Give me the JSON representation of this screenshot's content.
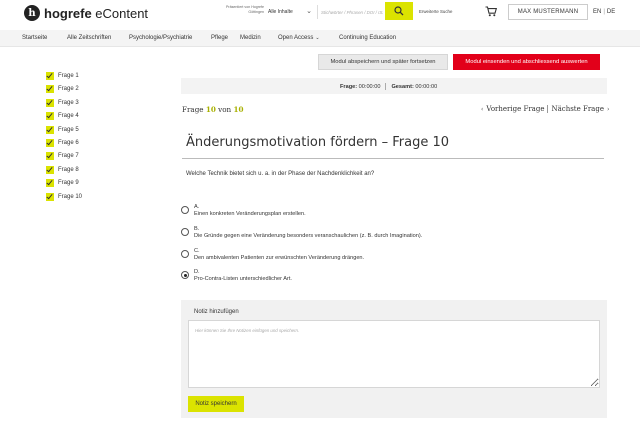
{
  "header": {
    "logo_mark": "h",
    "logo_brand": "hogrefe",
    "logo_product": " eContent",
    "presented_by": "Präsentiert von Hogrefe Göttingen",
    "scope_label": "Alle Inhalte",
    "search_placeholder": "Stichwörter / Phrasen / DOI / ISSN / ...",
    "advanced_search": "Erweiterte Suche",
    "user_name": "MAX MUSTERMANN",
    "lang_en": "EN",
    "lang_separator": "|",
    "lang_de": "DE",
    "accent_color": "#dbe300"
  },
  "nav": {
    "items": [
      "Startseite",
      "Alle Zeitschriften",
      "Psychologie/Psychiatrie",
      "Pflege",
      "Medizin",
      "Open Access",
      "Continuing Education"
    ]
  },
  "sidebar": {
    "items": [
      {
        "label": "Frage 1",
        "done": true
      },
      {
        "label": "Frage 2",
        "done": true
      },
      {
        "label": "Frage 3",
        "done": true
      },
      {
        "label": "Frage 4",
        "done": true
      },
      {
        "label": "Frage 5",
        "done": true
      },
      {
        "label": "Frage 6",
        "done": true
      },
      {
        "label": "Frage 7",
        "done": true
      },
      {
        "label": "Frage 8",
        "done": true
      },
      {
        "label": "Frage 9",
        "done": true
      },
      {
        "label": "Frage 10",
        "done": true
      }
    ]
  },
  "actions": {
    "save_later": "Modul abspeichern und später fortsetzen",
    "submit": "Modul einsenden und abschliessend auswerten",
    "submit_color": "#e2001a"
  },
  "timer": {
    "question_label": "Frage:",
    "question_time": "00:00:00",
    "total_label": "Gesamt:",
    "total_time": "00:00:00"
  },
  "question": {
    "counter_prefix": "Frage",
    "current": "10",
    "counter_of": "von",
    "total": "10",
    "prev_label": "Vorherige Frage",
    "next_label": "Nächste Frage",
    "title": "Änderungsmotivation fördern – Frage 10",
    "text": "Welche Technik bietet sich u. a. in der Phase der Nachdenklichkeit an?",
    "options": [
      {
        "letter": "A.",
        "text": "Einen konkreten Veränderungsplan erstellen.",
        "selected": false
      },
      {
        "letter": "B.",
        "text": "Die Gründe gegen eine Veränderung besonders veranschaulichen (z. B. durch Imagination).",
        "selected": false
      },
      {
        "letter": "C.",
        "text": "Den ambivalenten Patienten zur erwünschten Veränderung drängen.",
        "selected": false
      },
      {
        "letter": "D.",
        "text": "Pro-Contra-Listen unterschiedlicher Art.",
        "selected": true
      }
    ]
  },
  "note": {
    "label": "Notiz hinzufügen",
    "placeholder": "Hier können Sie Ihre Notizen einfügen und speichern.",
    "save_label": "Notiz speichern"
  }
}
